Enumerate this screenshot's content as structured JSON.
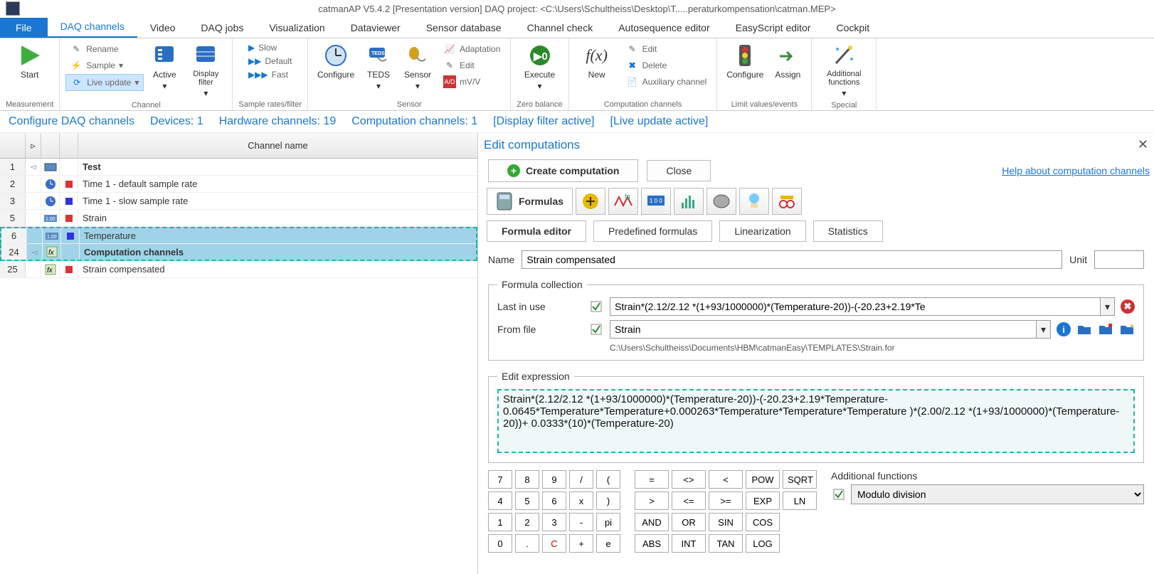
{
  "title": "catmanAP V5.4.2 [Presentation version]  DAQ project: <C:\\Users\\Schultheiss\\Desktop\\T.....peraturkompensation\\catman.MEP>",
  "menutabs": {
    "file": "File",
    "items": [
      "DAQ channels",
      "Video",
      "DAQ jobs",
      "Visualization",
      "Dataviewer",
      "Sensor database",
      "Channel check",
      "Autosequence editor",
      "EasyScript editor",
      "Cockpit"
    ],
    "active_index": 0
  },
  "ribbon": {
    "start": "Start",
    "measurement_label": "Measurement",
    "channel": {
      "rename": "Rename",
      "sample": "Sample",
      "live_update": "Live update",
      "active": "Active",
      "display_filter": "Display filter",
      "group_label": "Channel"
    },
    "rates": {
      "slow": "Slow",
      "default": "Default",
      "fast": "Fast",
      "group_label": "Sample rates/filter"
    },
    "sensor": {
      "configure": "Configure",
      "teds": "TEDS",
      "sensor": "Sensor",
      "adaptation": "Adaptation",
      "edit": "Edit",
      "mvv": "mV/V",
      "group_label": "Sensor"
    },
    "zero": {
      "execute": "Execute",
      "group_label": "Zero balance"
    },
    "comp": {
      "new": "New",
      "edit": "Edit",
      "delete": "Delete",
      "aux": "Auxiliary channel",
      "group_label": "Computation channels"
    },
    "limits": {
      "configure": "Configure",
      "assign": "Assign",
      "group_label": "Limit values/events"
    },
    "special": {
      "add": "Additional functions",
      "group_label": "Special"
    }
  },
  "statusrow": {
    "a": "Configure DAQ channels",
    "b": "Devices: 1",
    "c": "Hardware channels: 19",
    "d": "Computation channels: 1",
    "e": "[Display filter active]",
    "f": "[Live update active]"
  },
  "grid": {
    "header": "Channel name",
    "rows": [
      {
        "num": "1",
        "exp": "◅",
        "icon": "device",
        "flag": "",
        "name": "Test",
        "bold": true
      },
      {
        "num": "2",
        "exp": "",
        "icon": "clock",
        "flag": "red",
        "name": "Time  1 - default sample rate"
      },
      {
        "num": "3",
        "exp": "",
        "icon": "clock",
        "flag": "blue",
        "name": "Time  1 - slow sample rate"
      },
      {
        "num": "5",
        "exp": "",
        "icon": "bits",
        "flag": "red",
        "name": "Strain"
      },
      {
        "num": "6",
        "exp": "",
        "icon": "bits",
        "flag": "blue",
        "name": "Temperature",
        "selected": true
      },
      {
        "num": "24",
        "exp": "◅",
        "icon": "fx",
        "flag": "",
        "name": "Computation channels",
        "bold": true,
        "selected": true
      },
      {
        "num": "25",
        "exp": "",
        "icon": "fx2",
        "flag": "red",
        "name": "Strain compensated"
      }
    ]
  },
  "rp": {
    "title": "Edit computations",
    "create": "Create computation",
    "close": "Close",
    "help": "Help about computation channels",
    "formulas_tab": "Formulas",
    "subtabs": [
      "Formula editor",
      "Predefined formulas",
      "Linearization",
      "Statistics"
    ],
    "subtab_active": 0,
    "name_label": "Name",
    "name_value": "Strain compensated",
    "unit_label": "Unit",
    "unit_value": "",
    "fc_legend": "Formula collection",
    "last_in_use": "Last in use",
    "last_value": "Strain*(2.12/2.12 *(1+93/1000000)*(Temperature-20))-(-20.23+2.19*Te",
    "from_file": "From file",
    "from_value": "Strain",
    "path": "C:\\Users\\Schultheiss\\Documents\\HBM\\catmanEasy\\TEMPLATES\\Strain.for",
    "ee_legend": "Edit expression",
    "expression": "Strain*(2.12/2.12 *(1+93/1000000)*(Temperature-20))-(-20.23+2.19*Temperature-0.0645*Temperature*Temperature+0.000263*Temperature*Temperature*Temperature )*(2.00/2.12 *(1+93/1000000)*(Temperature-20))+ 0.0333*(10)*(Temperature-20)",
    "keypad": [
      "7",
      "8",
      "9",
      "/",
      "(",
      "4",
      "5",
      "6",
      "x",
      ")",
      "1",
      "2",
      "3",
      "-",
      "pi",
      "0",
      ".",
      "C",
      "+",
      "e"
    ],
    "fnpad": [
      "=",
      "<>",
      "<",
      "POW",
      "SQRT",
      "",
      ">",
      "<=",
      ">=",
      "EXP",
      "LN",
      "",
      "AND",
      "OR",
      "",
      "SIN",
      "COS",
      "",
      "ABS",
      "INT",
      "",
      "TAN",
      "LOG",
      ""
    ],
    "fnpad_rows": [
      [
        "=",
        "<>",
        "<",
        "POW",
        "SQRT"
      ],
      [
        ">",
        "<=",
        ">=",
        "EXP",
        "LN"
      ],
      [
        "AND",
        "OR",
        "SIN",
        "COS"
      ],
      [
        "ABS",
        "INT",
        "TAN",
        "LOG"
      ]
    ],
    "addfn_label": "Additional functions",
    "addfn_value": "Modulo division"
  }
}
